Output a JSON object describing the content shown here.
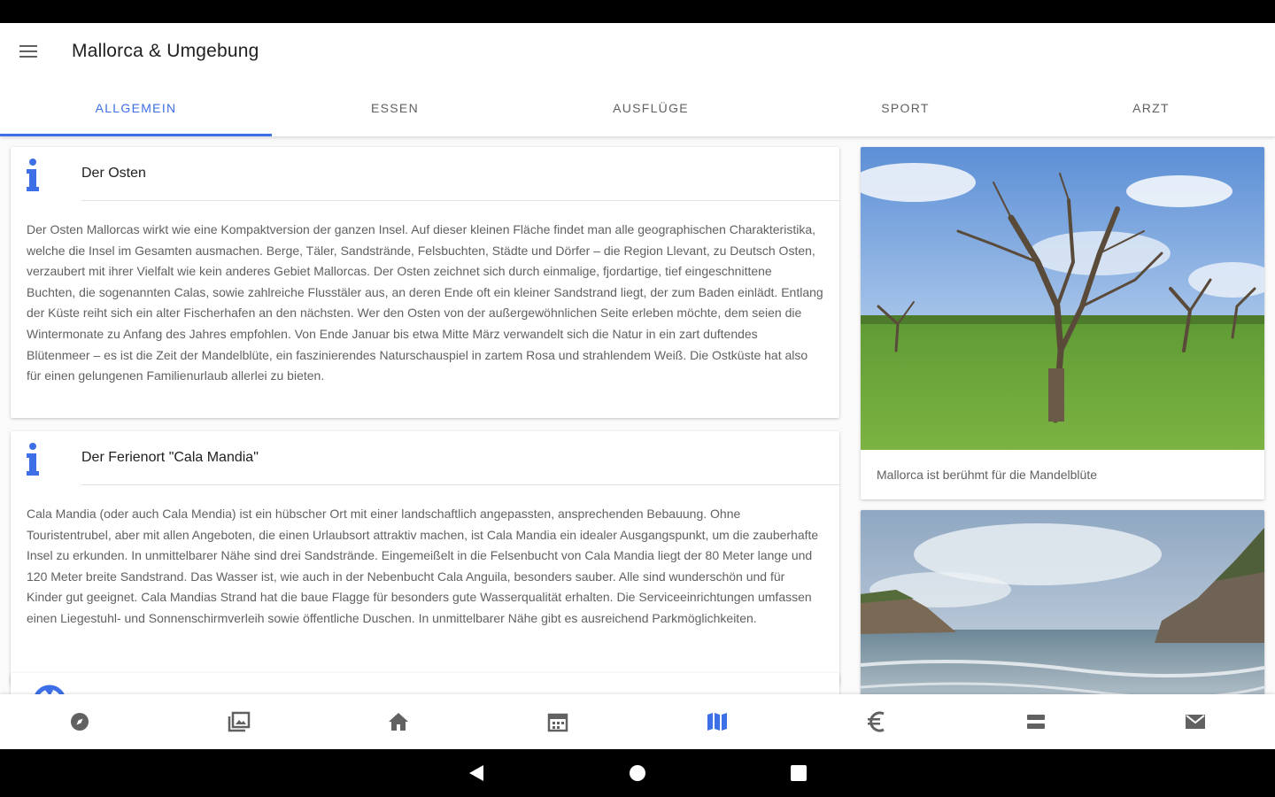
{
  "app": {
    "title": "Mallorca & Umgebung",
    "accent": "#3d6fe6"
  },
  "tabs": [
    {
      "label": "ALLGEMEIN",
      "active": true
    },
    {
      "label": "ESSEN",
      "active": false
    },
    {
      "label": "AUSFLÜGE",
      "active": false
    },
    {
      "label": "SPORT",
      "active": false
    },
    {
      "label": "ARZT",
      "active": false
    }
  ],
  "cards": [
    {
      "icon": "info-icon",
      "title": "Der Osten",
      "body": "Der Osten Mallorcas wirkt wie eine Kompaktversion der ganzen Insel. Auf dieser kleinen Fläche findet man alle geographischen Charakteristika, welche die Insel im Gesamten ausmachen. Berge, Täler, Sandstrände, Felsbuchten, Städte und Dörfer – die Region Llevant, zu Deutsch Osten, verzaubert mit ihrer Vielfalt wie kein anderes Gebiet Mallorcas. Der Osten zeichnet sich durch einmalige, fjordartige, tief eingeschnittene Buchten, die sogenannten Calas, sowie zahlreiche Flusstäler aus, an deren Ende oft ein kleiner Sandstrand liegt, der zum Baden einlädt. Entlang der Küste reiht sich ein alter Fischerhafen an den nächsten. Wer den Osten von der außergewöhnlichen Seite erleben möchte, dem seien die Wintermonate zu Anfang des Jahres empfohlen. Von Ende Januar bis etwa Mitte März verwandelt sich die Natur in ein zart duftendes Blütenmeer – es ist die Zeit der Mandelblüte, ein faszinierendes Naturschauspiel in zartem Rosa und strahlendem Weiß. Die Ostküste hat also für einen gelungenen Familienurlaub allerlei zu bieten."
    },
    {
      "icon": "info-icon",
      "title": "Der Ferienort \"Cala Mandia\"",
      "body": "Cala Mandia (oder auch Cala Mendia) ist ein hübscher Ort mit einer landschaftlich angepassten, ansprechenden Bebauung. Ohne Touristentrubel, aber mit allen Angeboten, die einen Urlaubsort attraktiv machen, ist Cala Mandia ein idealer Ausgangspunkt, um die zauberhafte Insel zu erkunden. In unmittelbarer Nähe sind drei Sandstrände. Eingemeißelt in die Felsenbucht von Cala Mandia liegt der 80 Meter lange und 120 Meter breite Sandstrand. Das Wasser ist, wie auch in der Nebenbucht Cala Anguila, besonders sauber. Alle sind wunderschön und für Kinder gut geeignet. Cala Mandias Strand hat die baue Flagge für besonders gute Wasserqualität erhalten. Die Serviceeinrichtungen umfassen einen Liegestuhl- und Sonnenschirmverleih sowie öffentliche Duschen. In unmittelbarer Nähe gibt es ausreichend Parkmöglichkeiten."
    }
  ],
  "side": [
    {
      "caption": "Mallorca ist berühmt für die Mandelblüte"
    }
  ],
  "bottom_nav": [
    {
      "icon": "compass-icon",
      "active": false
    },
    {
      "icon": "photo-library-icon",
      "active": false
    },
    {
      "icon": "home-icon",
      "active": false
    },
    {
      "icon": "calendar-icon",
      "active": false
    },
    {
      "icon": "map-icon",
      "active": true
    },
    {
      "icon": "euro-icon",
      "active": false
    },
    {
      "icon": "storage-icon",
      "active": false
    },
    {
      "icon": "mail-icon",
      "active": false
    }
  ],
  "system_nav": [
    "back-icon",
    "home-circle-icon",
    "recents-icon"
  ]
}
